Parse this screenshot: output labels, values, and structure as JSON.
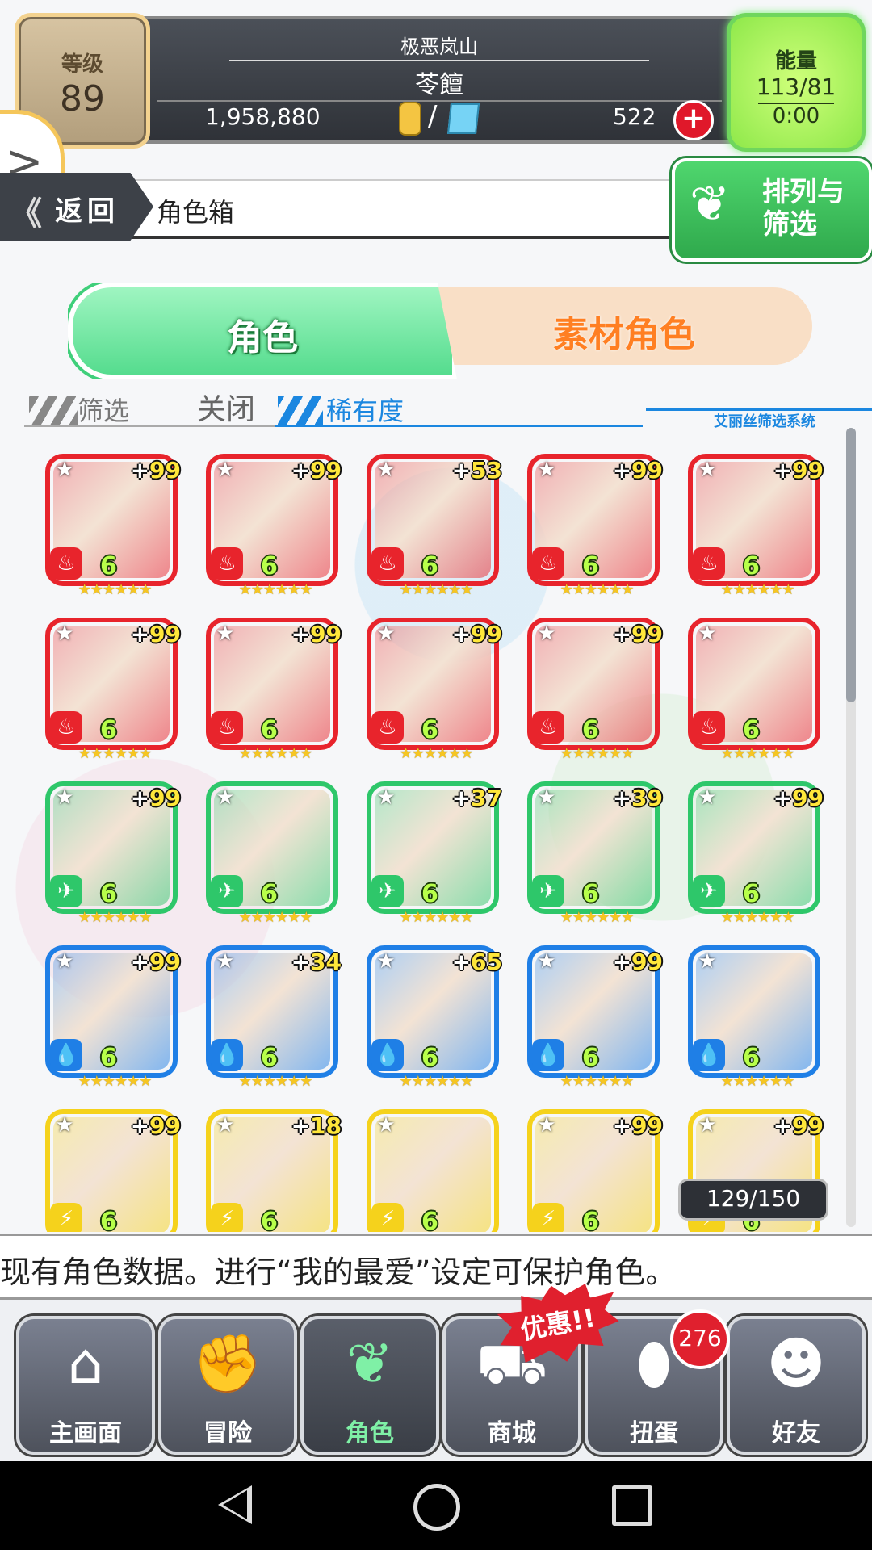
{
  "hud": {
    "level_label": "等级",
    "level": "89",
    "area_title": "极恶岚山",
    "player_name": "苓饘",
    "money": "1,958,880",
    "slash": "/",
    "gems": "522",
    "plus": "+",
    "energy_label": "能量",
    "energy": "113/81",
    "energy_timer": "0:00"
  },
  "nav_bar": {
    "side_arrow": ">",
    "back_label": "返回",
    "back_chevron": "《",
    "screen_title": "角色箱",
    "sort_label": "排列与筛选"
  },
  "tabs": [
    {
      "label": "角色",
      "active": true
    },
    {
      "label": "素材角色",
      "active": false
    }
  ],
  "filter": {
    "label": "筛选",
    "state": "关闭",
    "sort_by": "稀有度",
    "system_label": "艾丽丝筛选系统"
  },
  "element_colors": {
    "fire": "#e8242c",
    "wind": "#2ec76a",
    "water": "#1f7fe6",
    "thunder": "#f5d21c"
  },
  "characters": [
    {
      "plus": "99",
      "element": "fire",
      "grade": "6"
    },
    {
      "plus": "99",
      "element": "fire",
      "grade": "6"
    },
    {
      "plus": "53",
      "element": "fire",
      "grade": "6"
    },
    {
      "plus": "99",
      "element": "fire",
      "grade": "6"
    },
    {
      "plus": "99",
      "element": "fire",
      "grade": "6"
    },
    {
      "plus": "99",
      "element": "fire",
      "grade": "6"
    },
    {
      "plus": "99",
      "element": "fire",
      "grade": "6"
    },
    {
      "plus": "99",
      "element": "fire",
      "grade": "6"
    },
    {
      "plus": "99",
      "element": "fire",
      "grade": "6"
    },
    {
      "plus": "",
      "element": "fire",
      "grade": "6"
    },
    {
      "plus": "99",
      "element": "wind",
      "grade": "6"
    },
    {
      "plus": "",
      "element": "wind",
      "grade": "6"
    },
    {
      "plus": "37",
      "element": "wind",
      "grade": "6"
    },
    {
      "plus": "39",
      "element": "wind",
      "grade": "6"
    },
    {
      "plus": "99",
      "element": "wind",
      "grade": "6"
    },
    {
      "plus": "99",
      "element": "water",
      "grade": "6"
    },
    {
      "plus": "34",
      "element": "water",
      "grade": "6"
    },
    {
      "plus": "65",
      "element": "water",
      "grade": "6"
    },
    {
      "plus": "99",
      "element": "water",
      "grade": "6"
    },
    {
      "plus": "",
      "element": "water",
      "grade": "6"
    },
    {
      "plus": "99",
      "element": "thunder",
      "grade": "6"
    },
    {
      "plus": "18",
      "element": "thunder",
      "grade": "6"
    },
    {
      "plus": "",
      "element": "thunder",
      "grade": "6"
    },
    {
      "plus": "99",
      "element": "thunder",
      "grade": "6"
    },
    {
      "plus": "99",
      "element": "thunder",
      "grade": "6"
    }
  ],
  "box_count": "129/150",
  "ticker_text": "现有角色数据。进行“我的最爱”设定可保护角色。",
  "bottom_nav": [
    {
      "label": "主画面",
      "icon": "home-icon",
      "glyph": "⌂",
      "active": false
    },
    {
      "label": "冒险",
      "icon": "handshake-icon",
      "glyph": "✊",
      "active": false
    },
    {
      "label": "角色",
      "icon": "rabbit-icon",
      "glyph": "❦",
      "active": true
    },
    {
      "label": "商城",
      "icon": "cart-icon",
      "glyph": "⛟",
      "active": false
    },
    {
      "label": "扭蛋",
      "icon": "egg-icon",
      "glyph": "⬮",
      "active": false
    },
    {
      "label": "好友",
      "icon": "friends-icon",
      "glyph": "☻",
      "active": false
    }
  ],
  "promo_label": "优惠!!",
  "gacha_count": "276"
}
